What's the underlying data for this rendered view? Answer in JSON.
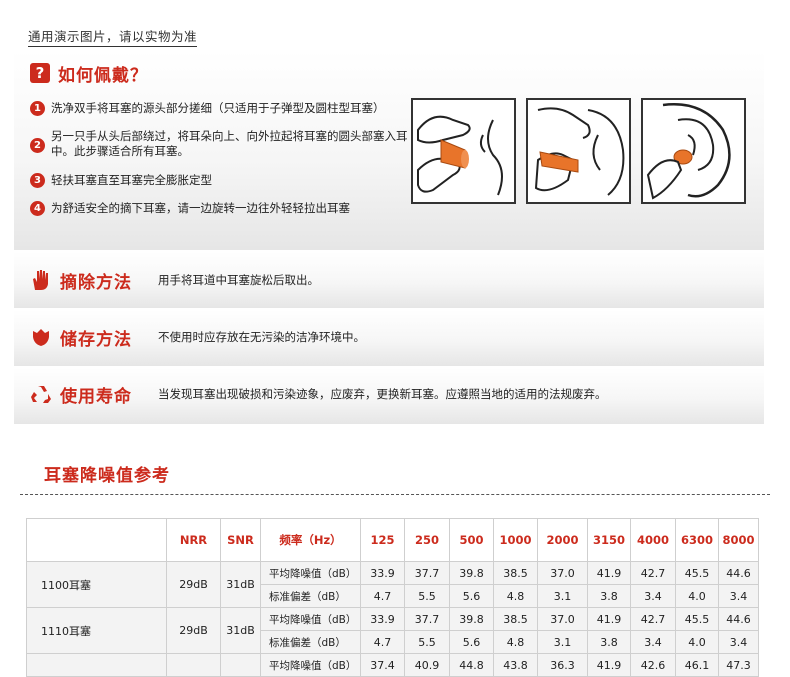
{
  "top_note": "通用演示图片，请以实物为准",
  "how_to": {
    "title": "如何佩戴？",
    "icon": "question-icon",
    "steps": [
      {
        "num": "1",
        "text": "洗净双手将耳塞的源头部分搓细（只适用于子弹型及圆柱型耳塞）"
      },
      {
        "num": "2",
        "text": "另一只手从头后部绕过，将耳朵向上、向外拉起将耳塞的圆头部塞入耳中。此步骤适合所有耳塞。"
      },
      {
        "num": "3",
        "text": "轻扶耳塞直至耳塞完全膨胀定型"
      },
      {
        "num": "4",
        "text": "为舒适安全的摘下耳塞，请一边旋转一边往外轻轻拉出耳塞"
      }
    ],
    "colors": {
      "accent": "#cc2b1d",
      "earplug": "#e8742a"
    }
  },
  "sections": [
    {
      "title": "摘除方法",
      "icon": "hand-icon",
      "desc": "用手将耳道中耳塞旋松后取出。"
    },
    {
      "title": "储存方法",
      "icon": "shield-icon",
      "desc": "不使用时应存放在无污染的洁净环境中。"
    },
    {
      "title": "使用寿命",
      "icon": "recycle-icon",
      "desc": "当发现耳塞出现破损和污染迹象，应废弃，更换新耳塞。应遵照当地的适用的法规废弃。"
    }
  ],
  "noise_ref": {
    "title": "耳塞降噪值参考",
    "headers": [
      "",
      "NRR",
      "SNR",
      "频率（Hz）",
      "125",
      "250",
      "500",
      "1000",
      "2000",
      "3150",
      "4000",
      "6300",
      "8000"
    ],
    "rows": [
      {
        "model": "1100耳塞",
        "nrr": "29dB",
        "snr": "31dB",
        "sub": [
          {
            "label": "平均降噪值（dB）",
            "values": [
              "33.9",
              "37.7",
              "39.8",
              "38.5",
              "37.0",
              "41.9",
              "42.7",
              "45.5",
              "44.6"
            ]
          },
          {
            "label": "标准偏差（dB）",
            "values": [
              "4.7",
              "5.5",
              "5.6",
              "4.8",
              "3.1",
              "3.8",
              "3.4",
              "4.0",
              "3.4"
            ]
          }
        ]
      },
      {
        "model": "1110耳塞",
        "nrr": "29dB",
        "snr": "31dB",
        "sub": [
          {
            "label": "平均降噪值（dB）",
            "values": [
              "33.9",
              "37.7",
              "39.8",
              "38.5",
              "37.0",
              "41.9",
              "42.7",
              "45.5",
              "44.6"
            ]
          },
          {
            "label": "标准偏差（dB）",
            "values": [
              "4.7",
              "5.5",
              "5.6",
              "4.8",
              "3.1",
              "3.8",
              "3.4",
              "4.0",
              "3.4"
            ]
          }
        ]
      },
      {
        "model": "",
        "nrr": "",
        "snr": "",
        "sub": [
          {
            "label": "平均降噪值（dB）",
            "values": [
              "37.4",
              "40.9",
              "44.8",
              "43.8",
              "36.3",
              "41.9",
              "42.6",
              "46.1",
              "47.3"
            ]
          }
        ]
      }
    ]
  }
}
